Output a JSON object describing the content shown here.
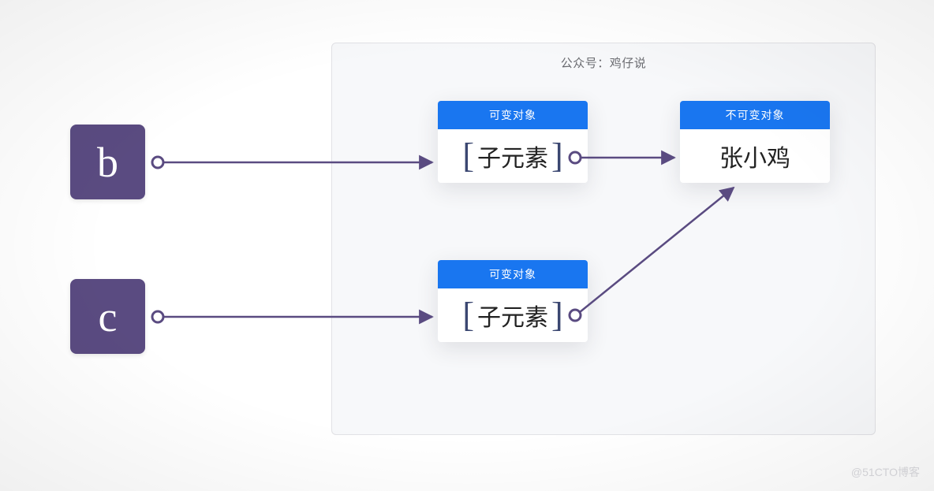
{
  "panel": {
    "title": "公众号：鸡仔说"
  },
  "vars": {
    "b": "b",
    "c": "c"
  },
  "cards": {
    "mutable1": {
      "header": "可变对象",
      "body": "子元素"
    },
    "mutable2": {
      "header": "可变对象",
      "body": "子元素"
    },
    "immutable": {
      "header": "不可变对象",
      "body": "张小鸡"
    }
  },
  "colors": {
    "variable": "#5a4b81",
    "cardHeader": "#1976f0",
    "panel": "#f7f8fa"
  },
  "watermark": "@51CTO博客"
}
